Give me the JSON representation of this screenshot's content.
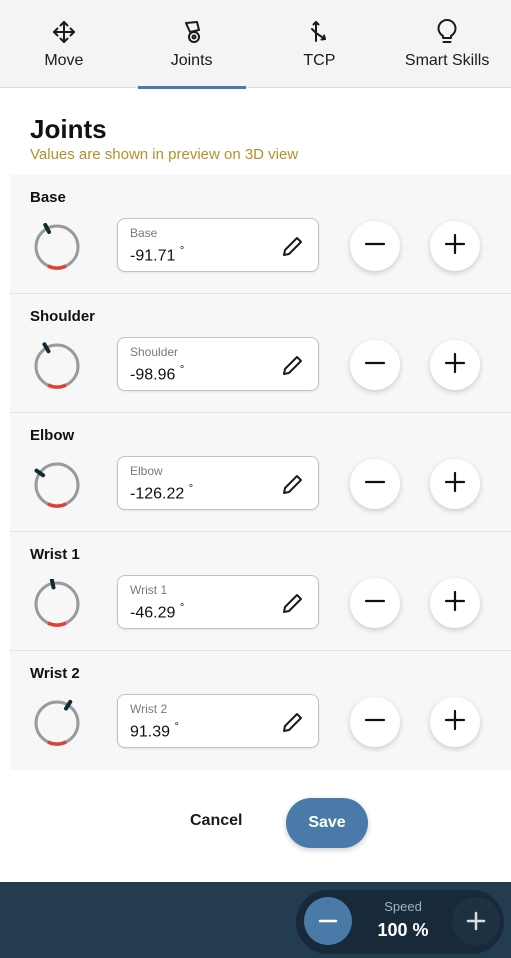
{
  "tabs": [
    {
      "label": "Move",
      "icon": "move-arrows-icon",
      "active": false
    },
    {
      "label": "Joints",
      "icon": "joints-icon",
      "active": true
    },
    {
      "label": "TCP",
      "icon": "tcp-axes-icon",
      "active": false
    },
    {
      "label": "Smart Skills",
      "icon": "lightbulb-icon",
      "active": false
    }
  ],
  "section": {
    "title": "Joints",
    "subtitle": "Values are shown in preview on 3D view"
  },
  "joints": [
    {
      "name": "Base",
      "field_label": "Base",
      "value": "-91.71",
      "unit": "°"
    },
    {
      "name": "Shoulder",
      "field_label": "Shoulder",
      "value": "-98.96",
      "unit": "°"
    },
    {
      "name": "Elbow",
      "field_label": "Elbow",
      "value": "-126.22",
      "unit": "°"
    },
    {
      "name": "Wrist 1",
      "field_label": "Wrist 1",
      "value": "-46.29",
      "unit": "°"
    },
    {
      "name": "Wrist 2",
      "field_label": "Wrist 2",
      "value": "91.39",
      "unit": "°"
    }
  ],
  "actions": {
    "cancel_label": "Cancel",
    "save_label": "Save"
  },
  "speed": {
    "label": "Speed",
    "value": "100 %"
  },
  "colors": {
    "accent": "#4a7aa8",
    "subtitle": "#b8902a",
    "dial_limit": "#e0403a",
    "dial_track": "#9a9a9a",
    "bottom_bar": "#243c4f"
  }
}
